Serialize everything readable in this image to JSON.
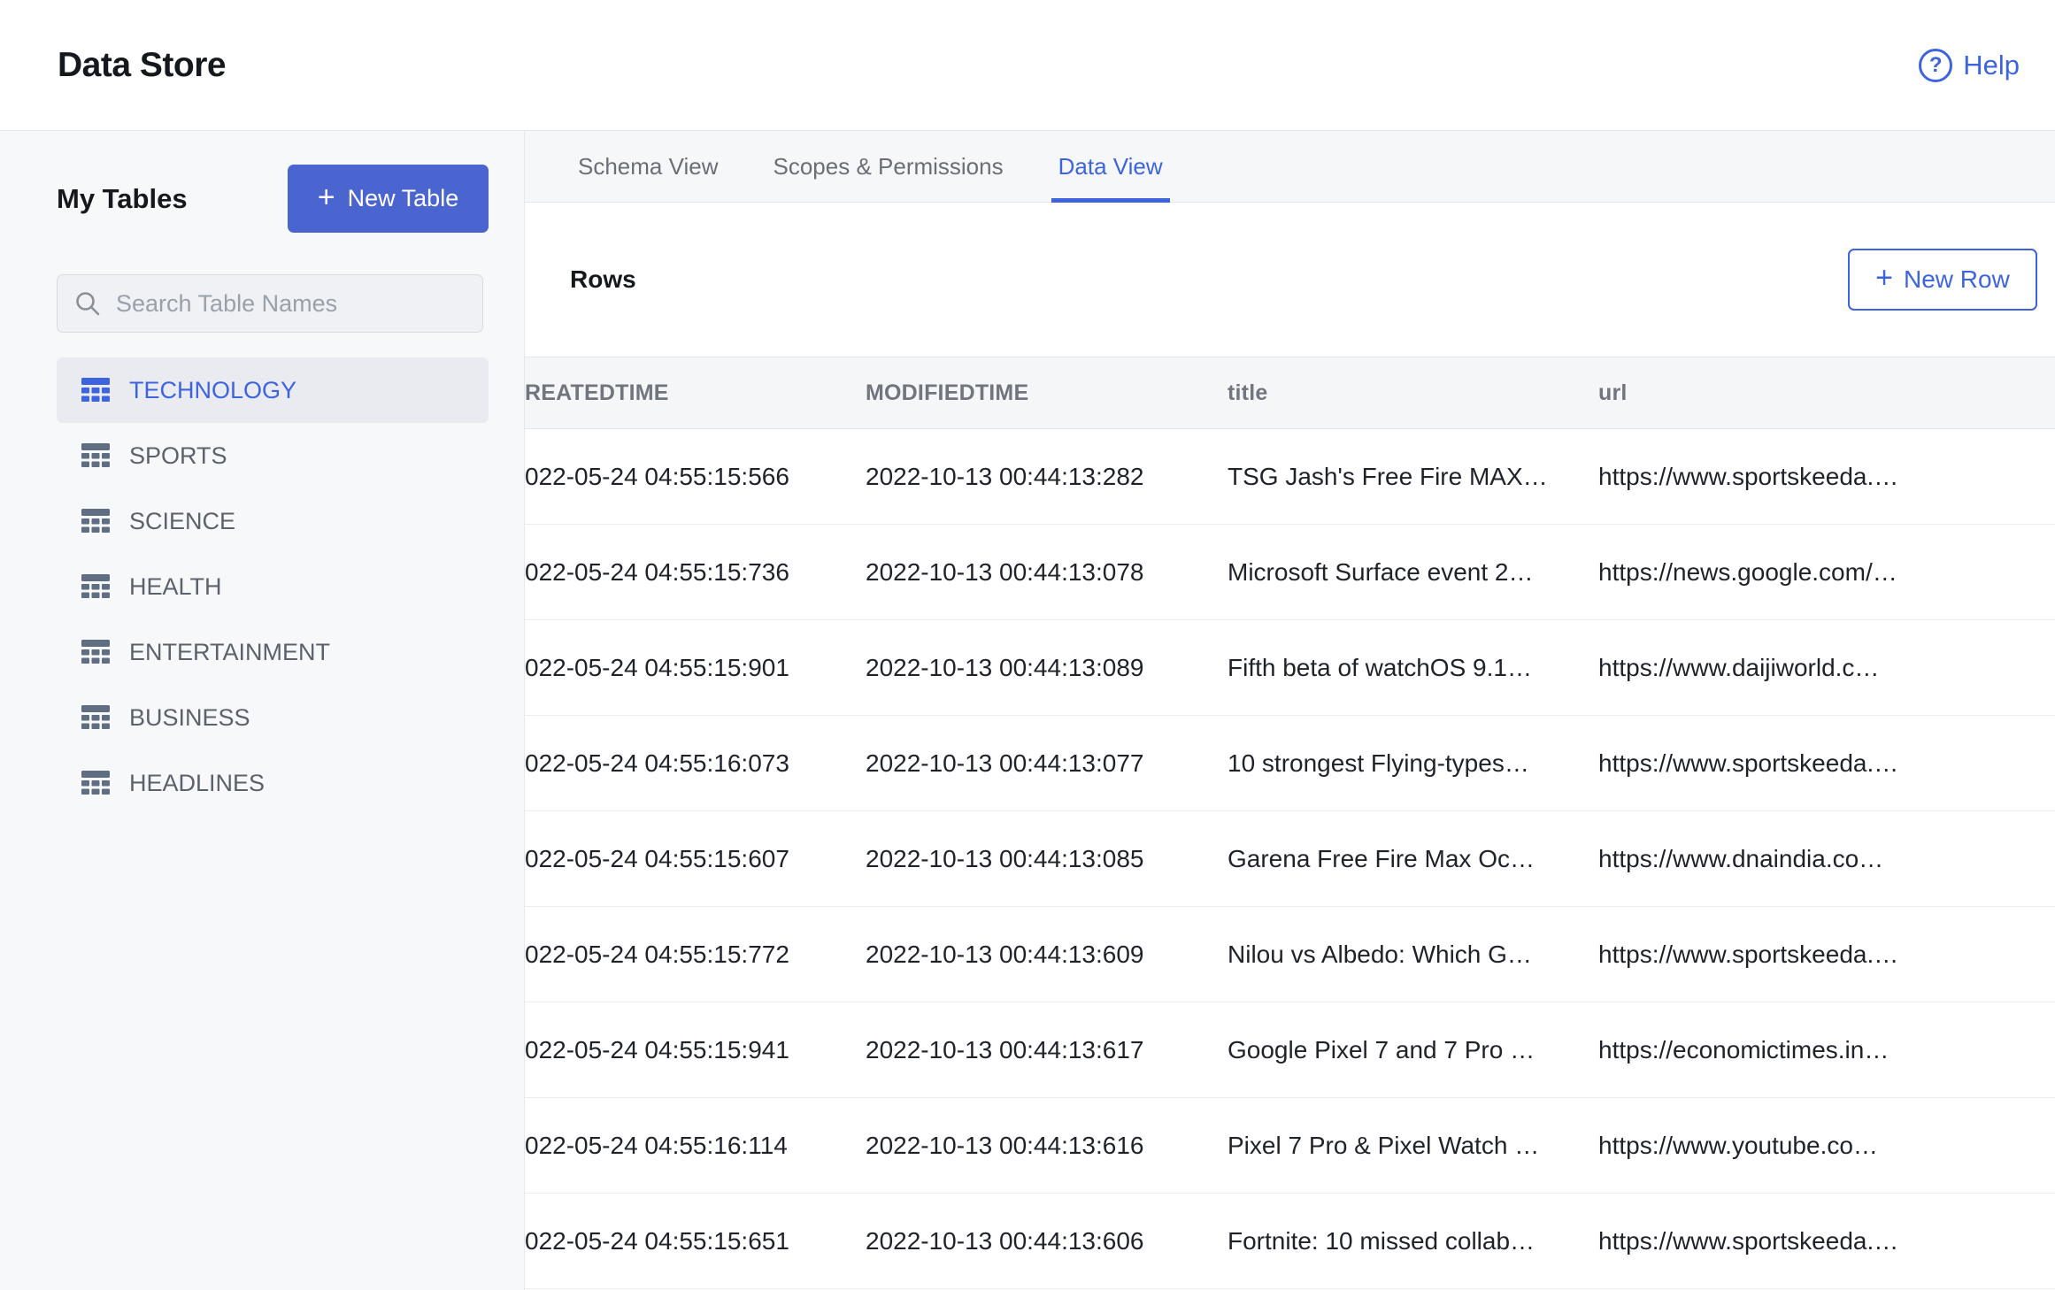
{
  "header": {
    "title": "Data Store",
    "help_label": "Help",
    "help_glyph": "?"
  },
  "sidebar": {
    "title": "My Tables",
    "new_table_plus": "+",
    "new_table_label": "New Table",
    "search_placeholder": "Search Table Names",
    "tables": [
      {
        "label": "TECHNOLOGY",
        "selected": true
      },
      {
        "label": "SPORTS"
      },
      {
        "label": "SCIENCE"
      },
      {
        "label": "HEALTH"
      },
      {
        "label": "ENTERTAINMENT"
      },
      {
        "label": "BUSINESS"
      },
      {
        "label": "HEADLINES"
      }
    ]
  },
  "tabs": [
    {
      "label": "Schema View"
    },
    {
      "label": "Scopes & Permissions"
    },
    {
      "label": "Data View",
      "selected": true
    }
  ],
  "toolbar": {
    "rows_label": "Rows",
    "new_row_plus": "+",
    "new_row_label": "New Row"
  },
  "table": {
    "columns": [
      {
        "label": "REATEDTIME"
      },
      {
        "label": "MODIFIEDTIME"
      },
      {
        "label": "title"
      },
      {
        "label": "url"
      }
    ],
    "rows": [
      {
        "created": "022-05-24 04:55:15:566",
        "modified": "2022-10-13 00:44:13:282",
        "title": "TSG Jash's Free Fire MAX…",
        "url": "https://www.sportskeeda.…"
      },
      {
        "created": "022-05-24 04:55:15:736",
        "modified": "2022-10-13 00:44:13:078",
        "title": "Microsoft Surface event 2…",
        "url": "https://news.google.com/…"
      },
      {
        "created": "022-05-24 04:55:15:901",
        "modified": "2022-10-13 00:44:13:089",
        "title": "Fifth beta of watchOS 9.1…",
        "url": "https://www.daijiworld.c…"
      },
      {
        "created": "022-05-24 04:55:16:073",
        "modified": "2022-10-13 00:44:13:077",
        "title": "10 strongest Flying-types…",
        "url": "https://www.sportskeeda.…"
      },
      {
        "created": "022-05-24 04:55:15:607",
        "modified": "2022-10-13 00:44:13:085",
        "title": "Garena Free Fire Max Oc…",
        "url": "https://www.dnaindia.co…"
      },
      {
        "created": "022-05-24 04:55:15:772",
        "modified": "2022-10-13 00:44:13:609",
        "title": "Nilou vs Albedo: Which G…",
        "url": "https://www.sportskeeda.…"
      },
      {
        "created": "022-05-24 04:55:15:941",
        "modified": "2022-10-13 00:44:13:617",
        "title": "Google Pixel 7 and 7 Pro …",
        "url": "https://economictimes.in…"
      },
      {
        "created": "022-05-24 04:55:16:114",
        "modified": "2022-10-13 00:44:13:616",
        "title": "Pixel 7 Pro & Pixel Watch …",
        "url": "https://www.youtube.co…"
      },
      {
        "created": "022-05-24 04:55:15:651",
        "modified": "2022-10-13 00:44:13:606",
        "title": "Fortnite: 10 missed collab…",
        "url": "https://www.sportskeeda.…"
      }
    ]
  },
  "colors": {
    "accent_blue": "#3e63de",
    "new_table_button": "#4a65d0",
    "sidebar_bg": "#f7f8f9",
    "selected_item_bg": "#e9ebf1",
    "table_header_bg": "#f5f6f8",
    "border": "#e6e8eb"
  }
}
